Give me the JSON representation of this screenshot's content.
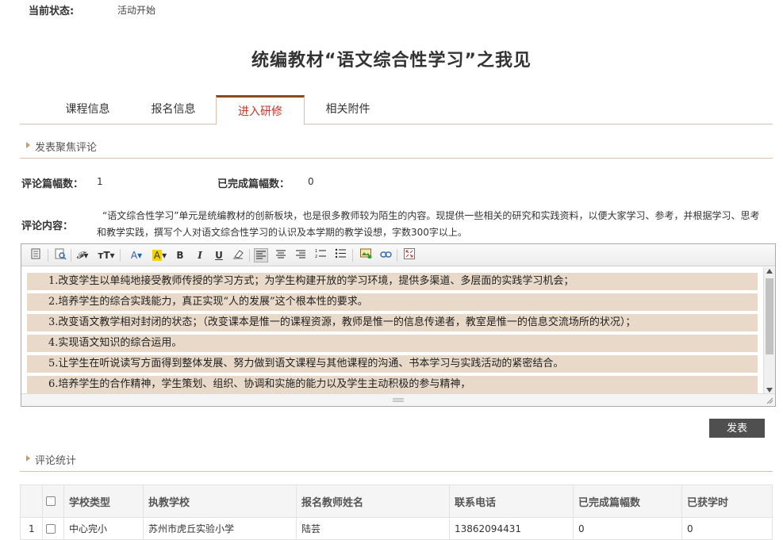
{
  "status": {
    "label": "当前状态:",
    "value": "活动开始"
  },
  "title": "统编教材“语文综合性学习”之我见",
  "tabs": [
    {
      "label": "课程信息",
      "active": false
    },
    {
      "label": "报名信息",
      "active": false
    },
    {
      "label": "进入研修",
      "active": true
    },
    {
      "label": "相关附件",
      "active": false
    }
  ],
  "section_comment": "发表聚焦评论",
  "counts": {
    "count_label": "评论篇幅数：",
    "count_value": "1",
    "done_label": "已完成篇幅数：",
    "done_value": "0"
  },
  "content_label": "评论内容：",
  "description": "“语文综合性学习”单元是统编教材的创新板块，也是很多教师较为陌生的内容。现提供一些相关的研究和实践资料，以便大家学习、参考，并根据学习、思考和教学实践，撰写个人对语文综合性学习的认识及本学期的教学设想，字数300字以上。",
  "toolbar_icons": [
    "source-icon",
    "preview-icon",
    "font-family-icon",
    "font-size-icon",
    "font-color-icon",
    "highlight-icon",
    "bold-icon",
    "italic-icon",
    "underline-icon",
    "eraser-icon",
    "align-left-icon",
    "align-center-icon",
    "align-right-icon",
    "ordered-list-icon",
    "unordered-list-icon",
    "image-icon",
    "link-icon",
    "fullscreen-icon"
  ],
  "editor_lines": [
    "1.改变学生以单纯地接受教师传授的学习方式；为学生构建开放的学习环境，提供多渠道、多层面的实践学习机会；",
    "2.培养学生的综合实践能力，真正实现“人的发展”这个根本性的要求。",
    "3.改变语文教学相对封闭的状态；（改变课本是惟一的课程资源，教师是惟一的信息传递者，教室是惟一的信息交流场所的状况）；",
    "4.实现语文知识的综合运用。",
    "5.让学生在听说读写方面得到整体发展、努力做到语文课程与其他课程的沟通、书本学习与实践活动的紧密结合。",
    "6.培养学生的合作精神，学生策划、组织、协调和实施的能力以及学生主动积极的参与精神，"
  ],
  "publish_label": "发表",
  "section_stats": "评论统计",
  "table": {
    "headers": [
      "学校类型",
      "执教学校",
      "报名教师姓名",
      "联系电话",
      "已完成篇幅数",
      "已获学时"
    ],
    "rows": [
      {
        "index": "1",
        "cells": [
          "中心完小",
          "苏州市虎丘实验小学",
          "陆芸",
          "13862094431",
          "0",
          "0"
        ]
      }
    ]
  }
}
